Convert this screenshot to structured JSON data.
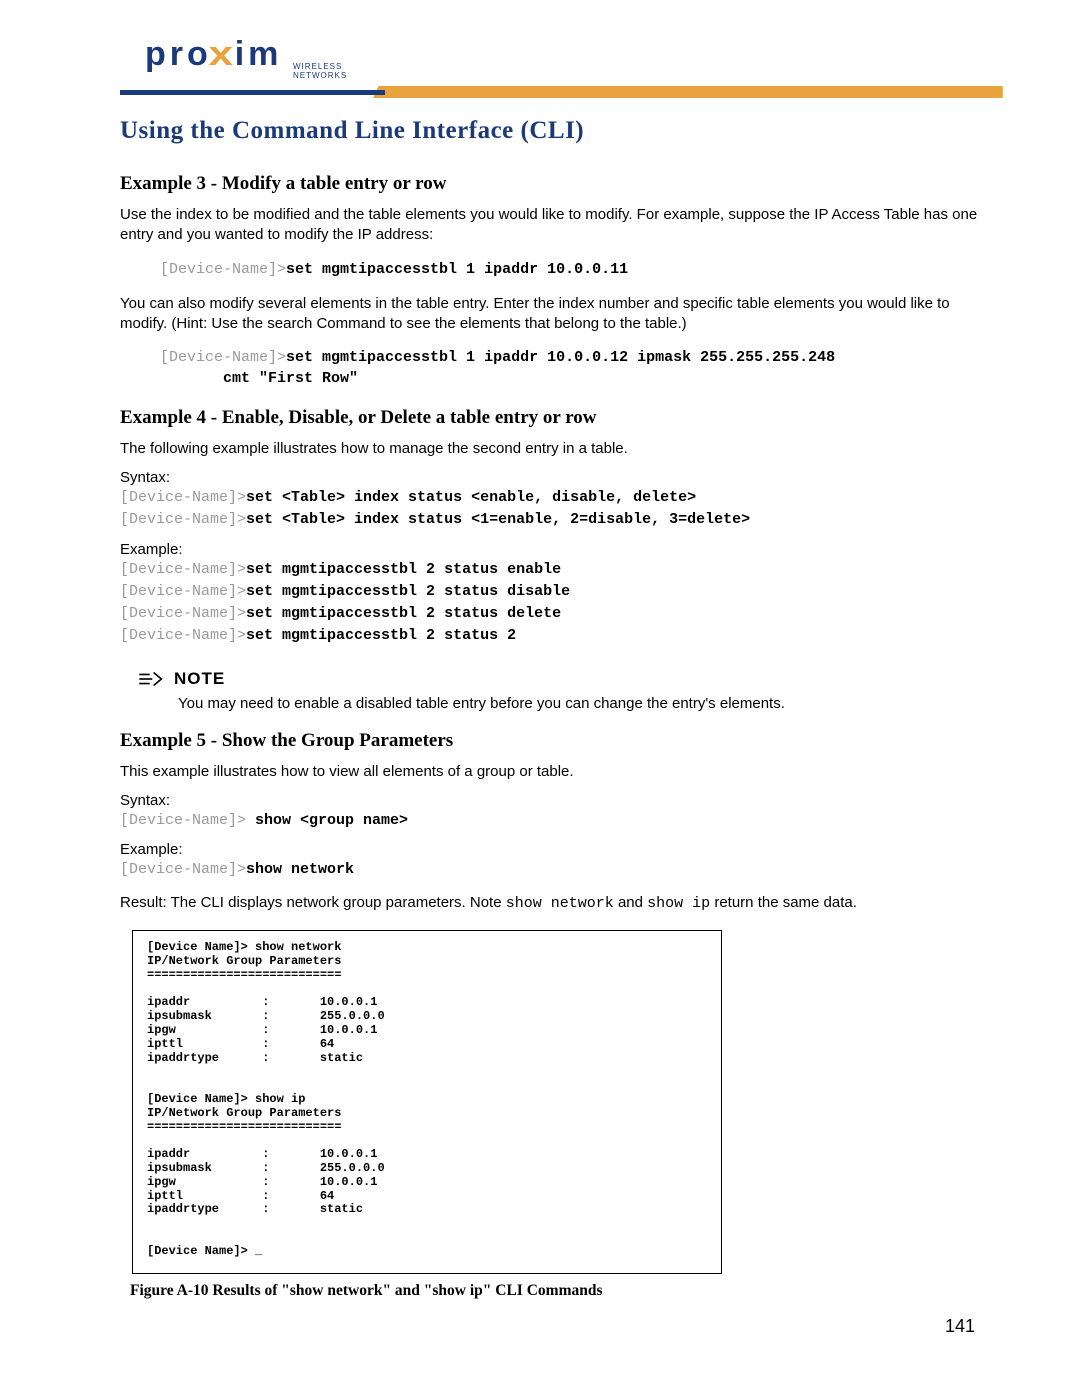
{
  "logo": {
    "text": "pro",
    "x": "x",
    "rest": "im",
    "subtitle": "WIRELESS NETWORKS"
  },
  "chapter_title": "Using the Command Line Interface (CLI)",
  "ex3": {
    "heading": "Example 3 - Modify a table entry or row",
    "p1": "Use the index to be modified and the table elements you would like to modify. For example, suppose the IP Access Table has one entry and you wanted to modify the IP address:",
    "code1_prompt": "[Device-Name]>",
    "code1_cmd": "set mgmtipaccesstbl 1 ipaddr 10.0.0.11",
    "p2": "You can also modify several elements in the table entry. Enter the index number and specific table elements you would like to modify. (Hint: Use the search Command to see the elements that belong to the table.)",
    "code2_prompt": "[Device-Name]>",
    "code2_line1": "set mgmtipaccesstbl 1 ipaddr 10.0.0.12 ipmask 255.255.255.248",
    "code2_line2": "       cmt \"First Row\""
  },
  "ex4": {
    "heading": "Example 4 - Enable, Disable, or Delete a table entry or row",
    "p1": "The following example illustrates how to manage the second entry in a table.",
    "syntax_label": "Syntax:",
    "syntax1_cmd": "set <Table> index status <enable, disable, delete>",
    "syntax2_cmd": "set <Table> index status <1=enable, 2=disable, 3=delete>",
    "example_label": "Example:",
    "ex_cmd1": "set mgmtipaccesstbl 2 status enable",
    "ex_cmd2": "set mgmtipaccesstbl 2 status disable",
    "ex_cmd3": "set mgmtipaccesstbl 2 status delete",
    "ex_cmd4": "set mgmtipaccesstbl 2 status 2",
    "prompt": "[Device-Name]>"
  },
  "note": {
    "label": "NOTE",
    "body": "You may need to enable a disabled table entry before you can change the entry's elements."
  },
  "ex5": {
    "heading": "Example 5 - Show the Group Parameters",
    "p1": "This example illustrates how to view all elements of a group or table.",
    "syntax_label": "Syntax:",
    "syntax_prompt": "[Device-Name]> ",
    "syntax_cmd": "show <group name>",
    "example_label": "Example:",
    "example_prompt": "[Device-Name]>",
    "example_cmd": "show network",
    "result_pre": "Result: The CLI displays network group parameters. Note ",
    "result_m1": "show network",
    "result_mid": " and ",
    "result_m2": "show ip",
    "result_post": " return the same data."
  },
  "terminal": "[Device Name]> show network\nIP/Network Group Parameters\n===========================\n\nipaddr          :       10.0.0.1\nipsubmask       :       255.0.0.0\nipgw            :       10.0.0.1\nipttl           :       64\nipaddrtype      :       static\n\n\n[Device Name]> show ip\nIP/Network Group Parameters\n===========================\n\nipaddr          :       10.0.0.1\nipsubmask       :       255.0.0.0\nipgw            :       10.0.0.1\nipttl           :       64\nipaddrtype      :       static\n\n\n[Device Name]> _",
  "figure_caption": "Figure A-10   Results of \"show network\" and \"show ip\" CLI Commands",
  "page_number": "141"
}
